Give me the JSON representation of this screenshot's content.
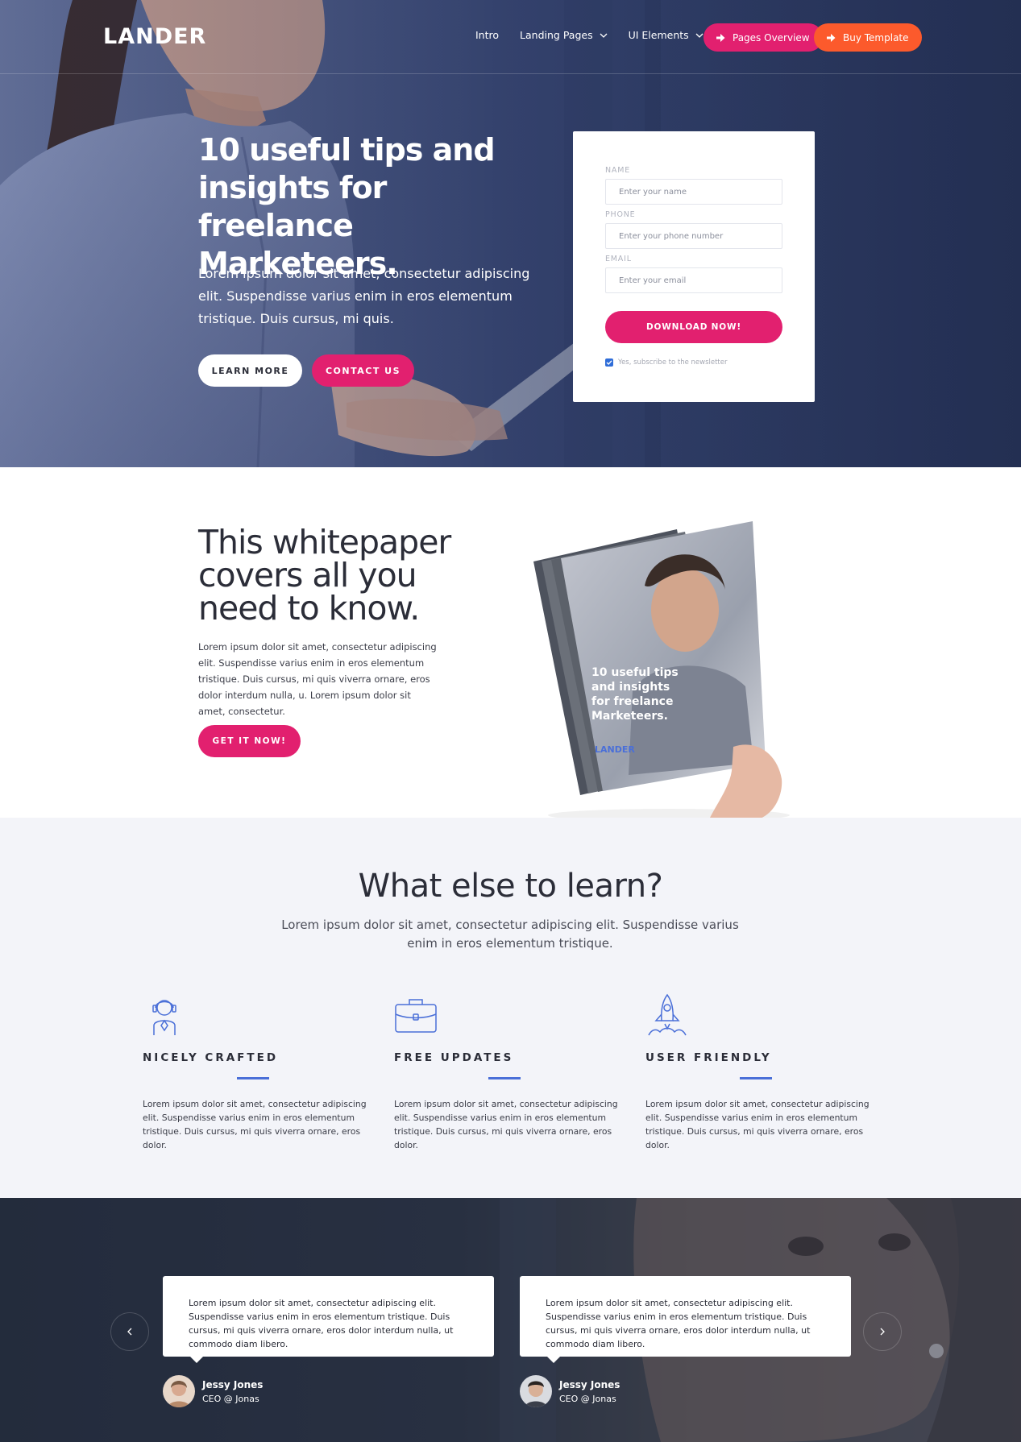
{
  "brand": {
    "logo": "LANDER"
  },
  "nav": {
    "links": [
      "Intro",
      "Landing Pages",
      "UI Elements"
    ],
    "pages_overview": "Pages Overview",
    "buy_template": "Buy Template"
  },
  "hero": {
    "title": "10 useful tips and insights for freelance Marketeers.",
    "subtitle": "Lorem ipsum dolor sit amet, consectetur adipiscing elit. Suspendisse varius enim in eros elementum tristique. Duis cursus, mi quis.",
    "learn_more": "LEARN MORE",
    "contact_us": "CONTACT US"
  },
  "form": {
    "name_label": "NAME",
    "name_placeholder": "Enter your name",
    "phone_label": "PHONE",
    "phone_placeholder": "Enter your phone number",
    "email_label": "EMAIL",
    "email_placeholder": "Enter your email",
    "submit": "DOWNLOAD NOW!",
    "newsletter_checked": true,
    "newsletter_label": "Yes, subscribe to the newsletter"
  },
  "whitepaper": {
    "title": "This whitepaper covers all you need to know.",
    "body": "Lorem ipsum dolor sit amet, consectetur adipiscing elit. Suspendisse varius enim in eros elementum tristique. Duis cursus, mi quis viverra ornare, eros dolor interdum nulla, u. Lorem ipsum dolor sit amet, consectetur.",
    "cta": "GET IT NOW!",
    "book_title": "10 useful tips and insights for freelance Marketeers.",
    "book_brand": "LANDER"
  },
  "features": {
    "title": "What else to learn?",
    "subtitle": "Lorem ipsum dolor sit amet, consectetur adipiscing elit. Suspendisse varius enim in eros elementum tristique.",
    "items": [
      {
        "icon": "support-agent-icon",
        "title": "NICELY CRAFTED",
        "text": "Lorem ipsum dolor sit amet, consectetur adipiscing elit. Suspendisse varius enim in eros elementum tristique. Duis cursus, mi quis viverra ornare, eros dolor."
      },
      {
        "icon": "briefcase-icon",
        "title": "FREE UPDATES",
        "text": "Lorem ipsum dolor sit amet, consectetur adipiscing elit. Suspendisse varius enim in eros elementum tristique. Duis cursus, mi quis viverra ornare, eros dolor."
      },
      {
        "icon": "rocket-icon",
        "title": "USER FRIENDLY",
        "text": "Lorem ipsum dolor sit amet, consectetur adipiscing elit. Suspendisse varius enim in eros elementum tristique. Duis cursus, mi quis viverra ornare, eros dolor."
      }
    ]
  },
  "testimonials": {
    "items": [
      {
        "quote": "Lorem ipsum dolor sit amet, consectetur adipiscing elit. Suspendisse varius enim in eros elementum tristique. Duis cursus, mi quis viverra ornare, eros dolor interdum nulla, ut commodo diam libero.",
        "name": "Jessy Jones",
        "role": "CEO @ Jonas"
      },
      {
        "quote": "Lorem ipsum dolor sit amet, consectetur adipiscing elit. Suspendisse varius enim in eros elementum tristique. Duis cursus, mi quis viverra ornare, eros dolor interdum nulla, ut commodo diam libero.",
        "name": "Jessy Jones",
        "role": "CEO @ Jonas"
      }
    ],
    "prev_icon": "chevron-left-icon",
    "next_icon": "chevron-right-icon"
  },
  "colors": {
    "primary": "#e2206f",
    "orange": "#fc5a2c",
    "accent_blue": "#4a6fd8",
    "hero_bg": "#2b3a63",
    "light_bg": "#f3f4f9"
  }
}
